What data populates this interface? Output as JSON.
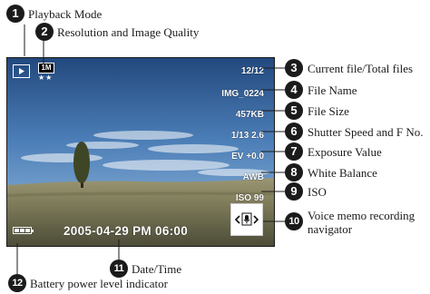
{
  "screen": {
    "datetime": "2005-04-29  PM 06:00",
    "resolution_badge": "1M",
    "quality_stars": "★★",
    "voice_memo_icon": "microphone-navigator-icon",
    "osd_items": [
      {
        "key": "counter",
        "text": "12/12"
      },
      {
        "key": "filename",
        "text": "IMG_0224"
      },
      {
        "key": "filesize",
        "text": "457KB"
      },
      {
        "key": "shutter_fno",
        "text": "1/13 2.6"
      },
      {
        "key": "exposure",
        "text": "EV +0.0"
      },
      {
        "key": "white_balance",
        "text": "AWB"
      },
      {
        "key": "iso",
        "text": "ISO 99"
      }
    ],
    "battery_cells": 3
  },
  "callouts": [
    {
      "num": "1",
      "label": "Playback Mode"
    },
    {
      "num": "2",
      "label": "Resolution and Image Quality"
    },
    {
      "num": "3",
      "label": "Current file/Total files"
    },
    {
      "num": "4",
      "label": "File Name"
    },
    {
      "num": "5",
      "label": "File Size"
    },
    {
      "num": "6",
      "label": "Shutter Speed and F No."
    },
    {
      "num": "7",
      "label": "Exposure Value"
    },
    {
      "num": "8",
      "label": "White Balance"
    },
    {
      "num": "9",
      "label": "ISO"
    },
    {
      "num": "10",
      "label": "Voice memo recording navigator"
    },
    {
      "num": "11",
      "label": "Date/Time"
    },
    {
      "num": "12",
      "label": "Battery power level indicator"
    }
  ]
}
